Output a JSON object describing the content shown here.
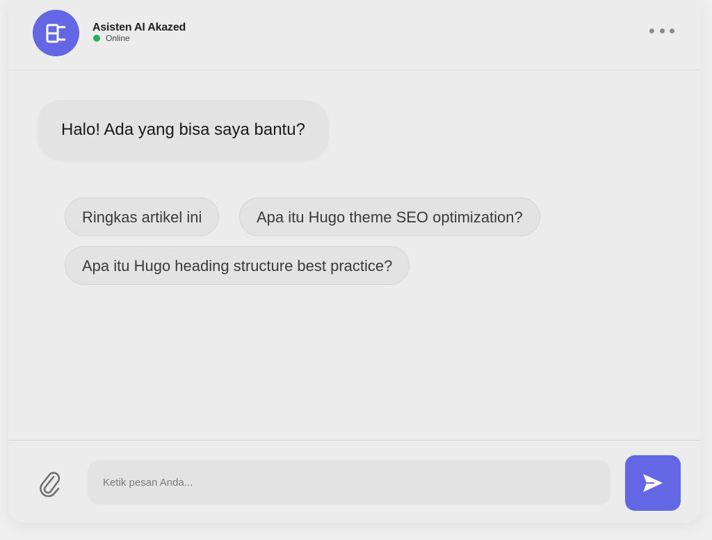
{
  "header": {
    "bot_name": "Asisten AI Akazed",
    "status": "Online",
    "avatar_icon": "akazed-logo-icon",
    "more_icon": "more-dots-icon"
  },
  "messages": [
    {
      "sender": "bot",
      "text": "Halo! Ada yang bisa saya bantu?"
    }
  ],
  "suggestions": [
    "Ringkas artikel ini",
    "Apa itu Hugo theme SEO optimization?",
    "Apa itu Hugo heading structure best practice?"
  ],
  "composer": {
    "placeholder": "Ketik pesan Anda...",
    "value": "",
    "attach_icon": "paperclip-icon",
    "send_icon": "send-icon"
  },
  "colors": {
    "accent": "#6367e3",
    "online": "#22b35a",
    "background": "#ececec",
    "bubble": "#e3e3e3"
  }
}
